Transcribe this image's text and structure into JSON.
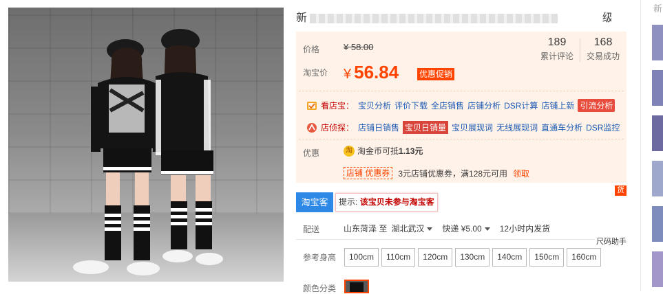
{
  "product": {
    "title_visible_prefix": "新",
    "title_visible_suffix": "级"
  },
  "price": {
    "label": "价格",
    "original": "¥ 58.00",
    "taobao_label": "淘宝价",
    "currency": "¥",
    "current": "56.84",
    "promo_tag": "优惠促销"
  },
  "stats": {
    "reviews_count": "189",
    "reviews_label": "累计评论",
    "sales_count": "168",
    "sales_label": "交易成功"
  },
  "tools": {
    "shop_label": "看店宝：",
    "shop_links": [
      "宝贝分析",
      "评价下载",
      "全店销售",
      "店铺分析",
      "DSR计算",
      "店铺上新",
      "引流分析"
    ],
    "detect_label": "店侦探：",
    "detect_links": [
      "店铺日销售",
      "宝贝日销量",
      "宝贝展现词",
      "无线展现词",
      "直通车分析",
      "DSR监控"
    ]
  },
  "discount": {
    "label": "优惠",
    "coin_icon_text": "淘",
    "coin_text": "淘金币可抵",
    "coin_amount": "1.13元",
    "coupon_tag": "店铺 优惠券",
    "coupon_text": "3元店铺优惠券，满128元可用",
    "coupon_link": "领取",
    "mini_tag": "货"
  },
  "taoke": {
    "button": "淘宝客",
    "tip_prefix": "提示:",
    "tip_bold": "该宝贝未参与淘宝客"
  },
  "shipping": {
    "label": "配送",
    "from": "山东菏泽 至",
    "to": "湖北武汉",
    "method": "快递 ¥5.00",
    "time": "12小时内发货",
    "size_helper": "尺码助手"
  },
  "height": {
    "label": "参考身高",
    "options": [
      "100cm",
      "110cm",
      "120cm",
      "130cm",
      "140cm",
      "150cm",
      "160cm"
    ]
  },
  "color": {
    "label": "颜色分类"
  },
  "right_col": {
    "top_char": "新"
  },
  "colors": {
    "accent": "#ff4400",
    "panel_bg": "#fff2e8",
    "link": "#1d5bb5",
    "taoke_blue": "#2e88e6"
  }
}
